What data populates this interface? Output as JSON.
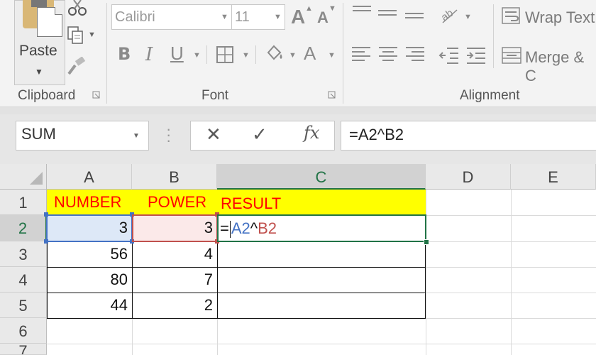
{
  "ribbon": {
    "clipboard": {
      "paste_label": "Paste",
      "group_label": "Clipboard"
    },
    "font": {
      "font_name": "Calibri",
      "font_size": "11",
      "grow_label": "A",
      "shrink_label": "A",
      "bold_label": "B",
      "italic_label": "I",
      "underline_label": "U",
      "font_color_label": "A",
      "group_label": "Font"
    },
    "alignment": {
      "wrap_text_label": "Wrap Text",
      "merge_label": "Merge & C",
      "group_label": "Alignment"
    }
  },
  "formula_bar": {
    "name_box": "SUM",
    "formula": "=A2^B2"
  },
  "grid": {
    "columns": [
      "A",
      "B",
      "C",
      "D",
      "E"
    ],
    "rows": [
      "1",
      "2",
      "3",
      "4",
      "5",
      "6",
      "7"
    ],
    "headers": {
      "a1": "NUMBER",
      "b1": "POWER",
      "c1": "RESULT"
    },
    "numbers": [
      "3",
      "56",
      "80",
      "44"
    ],
    "powers": [
      "3",
      "4",
      "7",
      "2"
    ],
    "edit_formula": {
      "eq": "=",
      "ref1": "A2",
      "op": "^",
      "ref2": "B2"
    }
  },
  "colors": {
    "accent_green": "#217346",
    "ref_blue": "#4472c4",
    "ref_red": "#c0504d",
    "header_fill": "#ffff00",
    "header_text": "#ff0000"
  },
  "icons": [
    "scissors-icon",
    "copy-icon",
    "format-painter-icon",
    "borders-icon",
    "fill-color-icon",
    "orientation-icon",
    "cancel-icon",
    "enter-icon",
    "insert-function-icon",
    "wrap-text-icon",
    "merge-icon",
    "dialog-launcher-icon"
  ]
}
